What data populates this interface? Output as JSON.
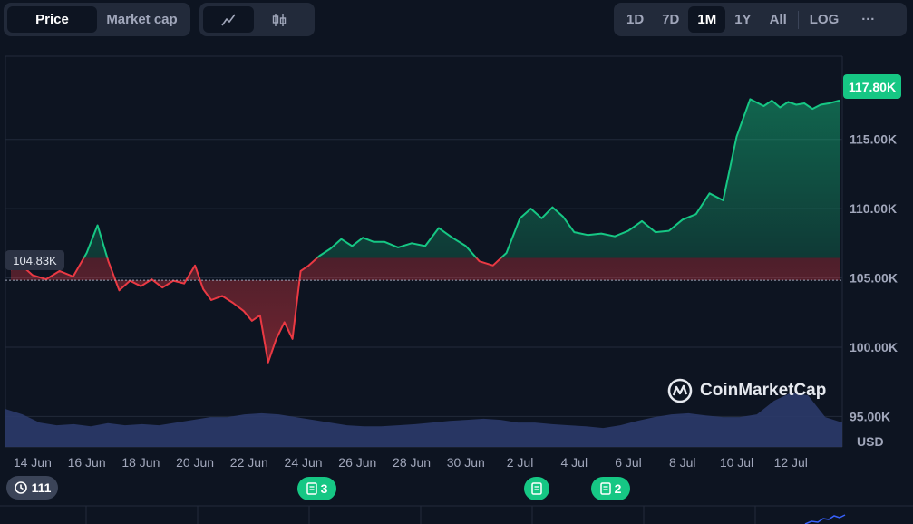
{
  "tabs": {
    "price": "Price",
    "market_cap": "Market cap"
  },
  "chart_types": [
    "line-chart-icon",
    "candlestick-icon"
  ],
  "ranges": [
    "1D",
    "7D",
    "1M",
    "1Y",
    "All"
  ],
  "active_range": "1M",
  "log_label": "LOG",
  "more_label": "···",
  "current_price": "117.80K",
  "reference_price": "104.83K",
  "currency": "USD",
  "history_count": "111",
  "news_markers": [
    {
      "date": "24 Jun",
      "count": "3"
    },
    {
      "date": "2 Jul",
      "count": ""
    },
    {
      "date": "5 Jul",
      "count": "2"
    }
  ],
  "brand": "CoinMarketCap",
  "colors": {
    "up": "#16c784",
    "down": "#ea3943",
    "volume": "#2b3a6a",
    "background": "#0d1421"
  },
  "chart_data": {
    "type": "area",
    "x_tick_labels": [
      "14 Jun",
      "16 Jun",
      "18 Jun",
      "20 Jun",
      "22 Jun",
      "24 Jun",
      "26 Jun",
      "28 Jun",
      "30 Jun",
      "2 Jul",
      "4 Jul",
      "6 Jul",
      "8 Jul",
      "10 Jul",
      "12 Jul"
    ],
    "y_tick_labels": [
      "115.00K",
      "110.00K",
      "105.00K",
      "100.00K",
      "95.00K"
    ],
    "ylim": [
      92.8,
      121.0
    ],
    "xlim": [
      13.0,
      43.9
    ],
    "reference_value": 104.83,
    "x_unit": "day of period (13 = 13 Jun)",
    "series": [
      {
        "x": [
          13.2,
          13.6,
          14.0,
          14.5,
          15.0,
          15.5,
          16.0,
          16.4,
          16.8,
          17.2,
          17.6,
          18.0,
          18.4,
          18.8,
          19.2,
          19.6,
          20.0,
          20.3,
          20.6,
          21.0,
          21.4,
          21.8,
          22.1,
          22.4,
          22.7,
          23.0,
          23.3,
          23.6,
          23.9,
          24.2,
          24.6,
          25.0,
          25.4,
          25.8,
          26.2,
          26.6,
          27.0,
          27.5,
          28.0,
          28.5,
          29.0,
          29.5,
          30.0,
          30.5,
          31.0,
          31.5,
          32.0,
          32.4,
          32.8,
          33.2,
          33.6,
          34.0,
          34.5,
          35.0,
          35.5,
          36.0,
          36.5,
          37.0,
          37.5,
          38.0,
          38.5,
          39.0,
          39.5,
          40.0,
          40.5,
          41.0,
          41.3,
          41.6,
          41.9,
          42.2,
          42.5,
          42.8,
          43.1,
          43.4,
          43.8
        ],
        "y": [
          105.6,
          105.9,
          105.2,
          104.9,
          105.5,
          105.1,
          106.8,
          108.8,
          106.2,
          104.1,
          104.8,
          104.4,
          104.9,
          104.3,
          104.8,
          104.6,
          105.9,
          104.2,
          103.4,
          103.7,
          103.2,
          102.6,
          101.9,
          102.3,
          98.9,
          100.6,
          101.8,
          100.6,
          105.5,
          105.9,
          106.6,
          107.1,
          107.8,
          107.3,
          107.9,
          107.6,
          107.6,
          107.2,
          107.5,
          107.3,
          108.6,
          107.9,
          107.3,
          106.2,
          105.9,
          106.8,
          109.3,
          110.0,
          109.3,
          110.1,
          109.4,
          108.3,
          108.1,
          108.2,
          108.0,
          108.4,
          109.1,
          108.3,
          108.4,
          109.2,
          109.6,
          111.1,
          110.6,
          115.2,
          117.9,
          117.4,
          117.8,
          117.3,
          117.7,
          117.5,
          117.6,
          117.2,
          117.5,
          117.6,
          117.8
        ]
      }
    ],
    "volume_relative": [
      0.7,
      0.6,
      0.45,
      0.4,
      0.42,
      0.38,
      0.44,
      0.4,
      0.42,
      0.4,
      0.45,
      0.5,
      0.55,
      0.55,
      0.6,
      0.62,
      0.6,
      0.55,
      0.5,
      0.45,
      0.4,
      0.38,
      0.38,
      0.4,
      0.42,
      0.45,
      0.48,
      0.5,
      0.52,
      0.5,
      0.45,
      0.45,
      0.42,
      0.4,
      0.38,
      0.35,
      0.4,
      0.48,
      0.55,
      0.6,
      0.62,
      0.58,
      0.55,
      0.55,
      0.6,
      0.85,
      1.0,
      0.95,
      0.55,
      0.45
    ]
  }
}
